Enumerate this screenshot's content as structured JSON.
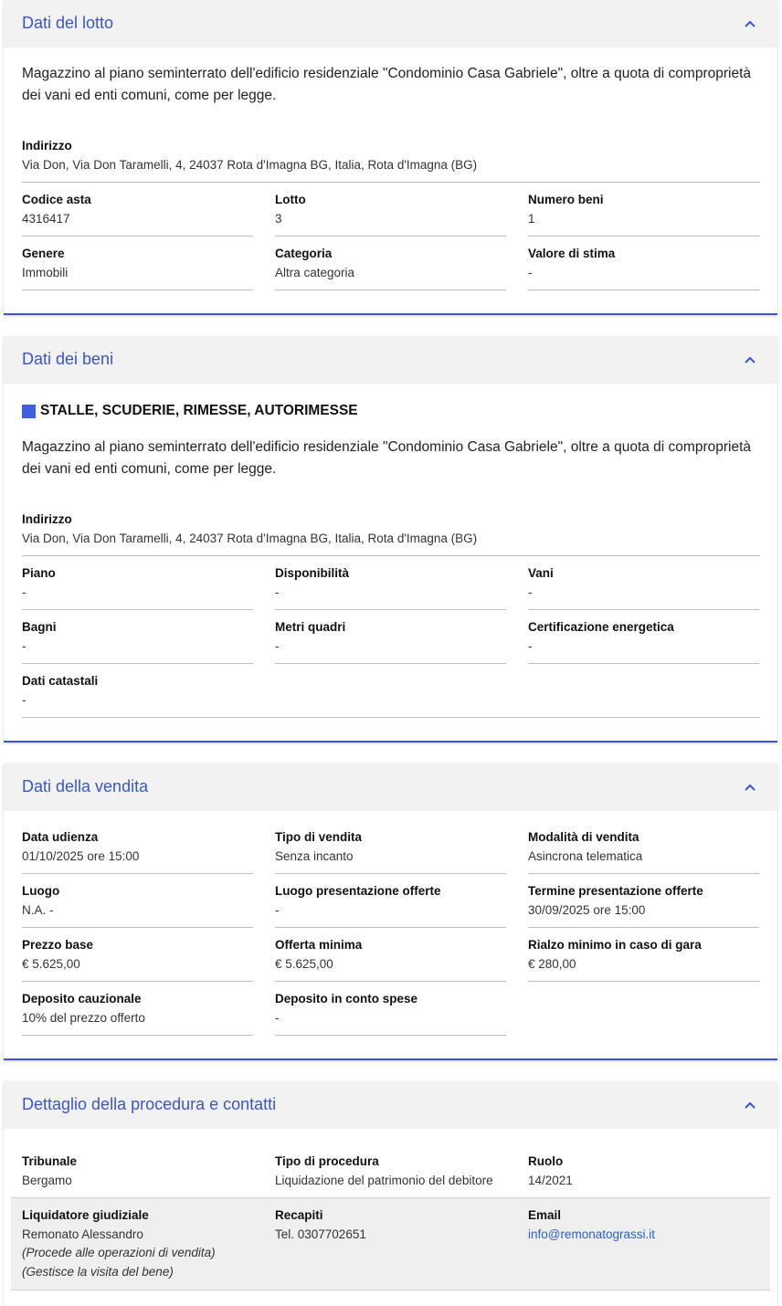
{
  "lotto": {
    "title": "Dati del lotto",
    "description": "Magazzino al piano seminterrato dell'edificio residenziale \"Condominio Casa Gabriele\", oltre a quota di comproprietà dei vani ed enti comuni, come per legge.",
    "indirizzo_label": "Indirizzo",
    "indirizzo_value": "Via Don, Via Don Taramelli, 4, 24037 Rota d'Imagna BG, Italia, Rota d'Imagna (BG)",
    "fields": [
      {
        "label": "Codice asta",
        "value": "4316417"
      },
      {
        "label": "Lotto",
        "value": "3"
      },
      {
        "label": "Numero beni",
        "value": "1"
      },
      {
        "label": "Genere",
        "value": "Immobili"
      },
      {
        "label": "Categoria",
        "value": "Altra categoria"
      },
      {
        "label": "Valore di stima",
        "value": "-"
      }
    ]
  },
  "beni": {
    "title": "Dati dei beni",
    "subtitle": "STALLE, SCUDERIE, RIMESSE, AUTORIMESSE",
    "description": "Magazzino al piano seminterrato dell'edificio residenziale \"Condominio Casa Gabriele\", oltre a quota di comproprietà dei vani ed enti comuni, come per legge.",
    "indirizzo_label": "Indirizzo",
    "indirizzo_value": "Via Don, Via Don Taramelli, 4, 24037 Rota d'Imagna BG, Italia, Rota d'Imagna (BG)",
    "fields": [
      {
        "label": "Piano",
        "value": "-"
      },
      {
        "label": "Disponibilità",
        "value": "-"
      },
      {
        "label": "Vani",
        "value": "-"
      },
      {
        "label": "Bagni",
        "value": "-"
      },
      {
        "label": "Metri quadri",
        "value": "-"
      },
      {
        "label": "Certificazione energetica",
        "value": "-"
      },
      {
        "label": "Dati catastali",
        "value": "-"
      }
    ]
  },
  "vendita": {
    "title": "Dati della vendita",
    "fields": [
      {
        "label": "Data udienza",
        "value": "01/10/2025 ore 15:00"
      },
      {
        "label": "Tipo di vendita",
        "value": "Senza incanto"
      },
      {
        "label": "Modalità di vendita",
        "value": "Asincrona telematica"
      },
      {
        "label": "Luogo",
        "value": "N.A. -"
      },
      {
        "label": "Luogo presentazione offerte",
        "value": "-"
      },
      {
        "label": "Termine presentazione offerte",
        "value": "30/09/2025 ore 15:00"
      },
      {
        "label": "Prezzo base",
        "value": "€ 5.625,00"
      },
      {
        "label": "Offerta minima",
        "value": "€ 5.625,00"
      },
      {
        "label": "Rialzo minimo in caso di gara",
        "value": "€ 280,00"
      },
      {
        "label": "Deposito cauzionale",
        "value": "10% del prezzo offerto"
      },
      {
        "label": "Deposito in conto spese",
        "value": "-"
      }
    ]
  },
  "procedura": {
    "title": "Dettaglio della procedura e contatti",
    "fields": [
      {
        "label": "Tribunale",
        "value": "Bergamo"
      },
      {
        "label": "Tipo di procedura",
        "value": "Liquidazione del patrimonio del debitore"
      },
      {
        "label": "Ruolo",
        "value": "14/2021"
      }
    ],
    "contatto": {
      "role_label": "Liquidatore giudiziale",
      "name": "Remonato Alessandro",
      "note1": "(Procede alle operazioni di vendita)",
      "note2": "(Gestisce la visita del bene)",
      "recapiti_label": "Recapiti",
      "recapiti_value": "Tel. 0307702651",
      "email_label": "Email",
      "email_value": "info@remonatograssi.it"
    }
  },
  "colors": {
    "accent": "#3f51d8",
    "title": "#3a55c9",
    "link": "#2a5fc9"
  }
}
